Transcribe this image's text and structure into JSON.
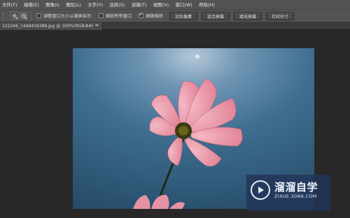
{
  "menubar": {
    "items": [
      "文件(F)",
      "编辑(E)",
      "图像(I)",
      "图层(L)",
      "文字(Y)",
      "选择(S)",
      "滤镜(T)",
      "视图(V)",
      "窗口(W)",
      "帮助(H)"
    ]
  },
  "options_bar": {
    "zoom_in_icon": "zoom-in",
    "zoom_out_icon": "zoom-out",
    "resize_windows": {
      "label": "调整窗口大小以满屏显示",
      "checked": false
    },
    "zoom_all_windows": {
      "label": "缩放所有窗口",
      "checked": false
    },
    "scrubby_zoom": {
      "label": "细微缩放",
      "checked": true
    },
    "buttons": [
      "实际像素",
      "适合屏幕",
      "填充屏幕",
      "打印尺寸"
    ]
  },
  "document_tab": {
    "title": "122246_1448409388.jpg @ 100%(RGB/8#) *",
    "close": "×"
  },
  "watermark": {
    "brand": "溜溜自学",
    "url": "ZIXUE.3D66.COM",
    "icon": "play-icon"
  },
  "colors": {
    "panel": "#535353",
    "workspace": "#282828",
    "sky": "#2f5a78",
    "petal": "#e99aa9",
    "watermark_bg": "#223458"
  }
}
